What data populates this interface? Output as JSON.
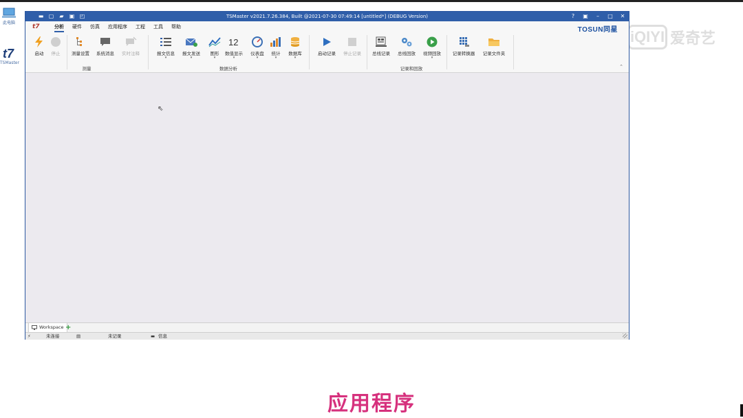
{
  "desktop": {
    "icon1_label": "此电脑",
    "icon2_label": "TSMaster",
    "watermark": {
      "logo": "iQIYI",
      "text": "爱奇艺"
    }
  },
  "window": {
    "title": "TSMaster v2021.7.26.384, Built @2021-07-30 07:49:14 [untitled*] (DEBUG Version)",
    "controls": [
      "?",
      "▣",
      "–",
      "□",
      "✕"
    ],
    "brand": "TOSUN同星",
    "app_logo": "t7"
  },
  "menu": {
    "items": [
      "分析",
      "硬件",
      "仿真",
      "应用程序",
      "工程",
      "工具",
      "帮助"
    ],
    "active": "分析"
  },
  "ribbon": {
    "groups": [
      {
        "label": "测量",
        "buttons": [
          {
            "label": "启动",
            "icon": "lightning-icon",
            "enabled": true
          },
          {
            "label": "停止",
            "icon": "stop-circle-icon",
            "enabled": false
          },
          {
            "label": "测量设置",
            "icon": "tree-icon",
            "enabled": true
          },
          {
            "label": "系统消息",
            "icon": "chat-icon",
            "enabled": true
          },
          {
            "label": "实时注释",
            "icon": "comment-icon",
            "enabled": false
          }
        ]
      },
      {
        "label": "数据分析",
        "buttons": [
          {
            "label": "报文信息",
            "icon": "list-icon",
            "enabled": true
          },
          {
            "label": "报文发送",
            "icon": "envelope-icon",
            "enabled": true
          },
          {
            "label": "图形",
            "icon": "graph-icon",
            "enabled": true
          },
          {
            "label": "数值显示",
            "icon": "number-icon",
            "enabled": true,
            "glyph": "12"
          },
          {
            "label": "仪表盘",
            "icon": "gauge-icon",
            "enabled": true
          },
          {
            "label": "统计",
            "icon": "bar-chart-icon",
            "enabled": true
          },
          {
            "label": "数据库",
            "icon": "database-icon",
            "enabled": true
          }
        ]
      },
      {
        "label": "记录和回放",
        "buttons": [
          {
            "label": "启动记录",
            "icon": "play-icon",
            "enabled": true
          },
          {
            "label": "停止记录",
            "icon": "stop-icon",
            "enabled": false
          },
          {
            "label": "总线记录",
            "icon": "bus-record-icon",
            "enabled": true
          },
          {
            "label": "总线回放",
            "icon": "gears-icon",
            "enabled": true
          },
          {
            "label": "视频回放",
            "icon": "video-play-icon",
            "enabled": true
          },
          {
            "label": "记录转换器",
            "icon": "grid-convert-icon",
            "enabled": true
          },
          {
            "label": "记录文件夹",
            "icon": "folder-icon",
            "enabled": true
          }
        ]
      }
    ]
  },
  "workspace": {
    "tab_label": "Workspace",
    "add_tab": "+"
  },
  "status": {
    "connection": "未连接",
    "recording": "未记录",
    "info": "信息"
  },
  "subtitle": "应用程序",
  "colors": {
    "titlebar": "#2f5ea9",
    "subtitle": "#d6317d",
    "brand": "#1a4fa0",
    "workspace_bg": "#eceaef"
  }
}
